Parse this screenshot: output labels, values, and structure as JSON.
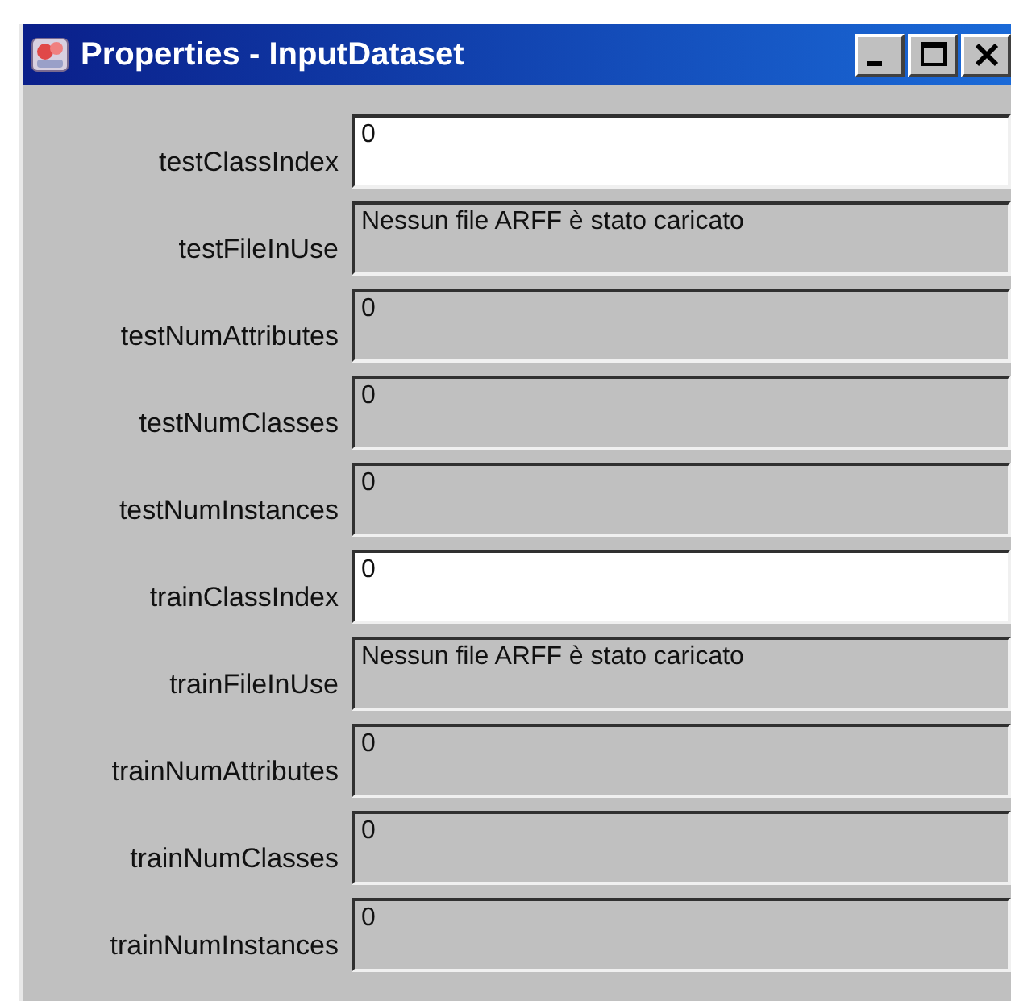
{
  "window": {
    "title": "Properties - InputDataset"
  },
  "properties": [
    {
      "label": "testClassIndex",
      "value": "0",
      "editable": true
    },
    {
      "label": "testFileInUse",
      "value": "Nessun file ARFF è stato caricato",
      "editable": false
    },
    {
      "label": "testNumAttributes",
      "value": "0",
      "editable": false
    },
    {
      "label": "testNumClasses",
      "value": "0",
      "editable": false
    },
    {
      "label": "testNumInstances",
      "value": "0",
      "editable": false
    },
    {
      "label": "trainClassIndex",
      "value": "0",
      "editable": true
    },
    {
      "label": "trainFileInUse",
      "value": "Nessun file ARFF è stato caricato",
      "editable": false
    },
    {
      "label": "trainNumAttributes",
      "value": "0",
      "editable": false
    },
    {
      "label": "trainNumClasses",
      "value": "0",
      "editable": false
    },
    {
      "label": "trainNumInstances",
      "value": "0",
      "editable": false
    }
  ]
}
